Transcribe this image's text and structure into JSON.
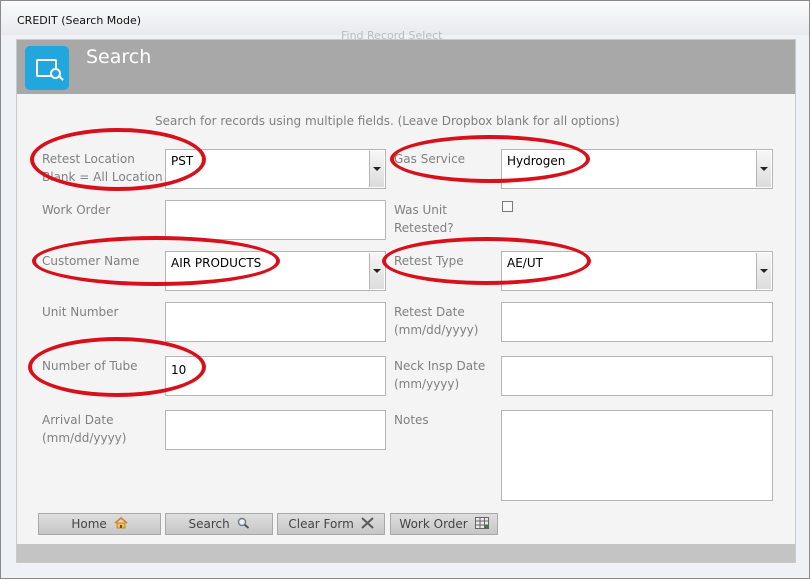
{
  "window": {
    "title": "CREDIT (Search Mode)",
    "ghost_title": "Find Record Select"
  },
  "header": {
    "title": "Search",
    "icon": "search-screen-icon",
    "color": "#22a6de"
  },
  "instructions": "Search for records using multiple fields. (Leave Dropbox blank for all options)",
  "fields": {
    "retest_location": {
      "label_line1": "Retest Location",
      "label_line2": "Blank = All Location",
      "value": "PST"
    },
    "gas_service": {
      "label": "Gas Service",
      "value": "Hydrogen"
    },
    "work_order": {
      "label": "Work Order",
      "value": ""
    },
    "was_unit_retested": {
      "label_line1": "Was Unit",
      "label_line2": "Retested?",
      "checked": false
    },
    "customer_name": {
      "label": "Customer Name",
      "value": "AIR PRODUCTS"
    },
    "retest_type": {
      "label": "Retest Type",
      "value": "AE/UT"
    },
    "unit_number": {
      "label": "Unit Number",
      "value": ""
    },
    "retest_date": {
      "label_line1": "Retest Date",
      "label_line2": "(mm/dd/yyyy)",
      "value": ""
    },
    "number_of_tube": {
      "label": "Number of Tube",
      "value": "10"
    },
    "neck_insp_date": {
      "label_line1": "Neck Insp Date",
      "label_line2": "(mm/yyyy)",
      "value": ""
    },
    "arrival_date": {
      "label_line1": "Arrival Date",
      "label_line2": "(mm/dd/yyyy)",
      "value": ""
    },
    "notes": {
      "label": "Notes",
      "value": ""
    }
  },
  "buttons": {
    "home": {
      "label": "Home",
      "icon": "house-icon"
    },
    "search": {
      "label": "Search",
      "icon": "magnifier-icon"
    },
    "clear_form": {
      "label": "Clear Form",
      "icon": "x-icon"
    },
    "work_order": {
      "label": "Work Order",
      "icon": "table-icon"
    }
  },
  "colors": {
    "annotation": "#d7101c",
    "accent": "#22a6de"
  }
}
